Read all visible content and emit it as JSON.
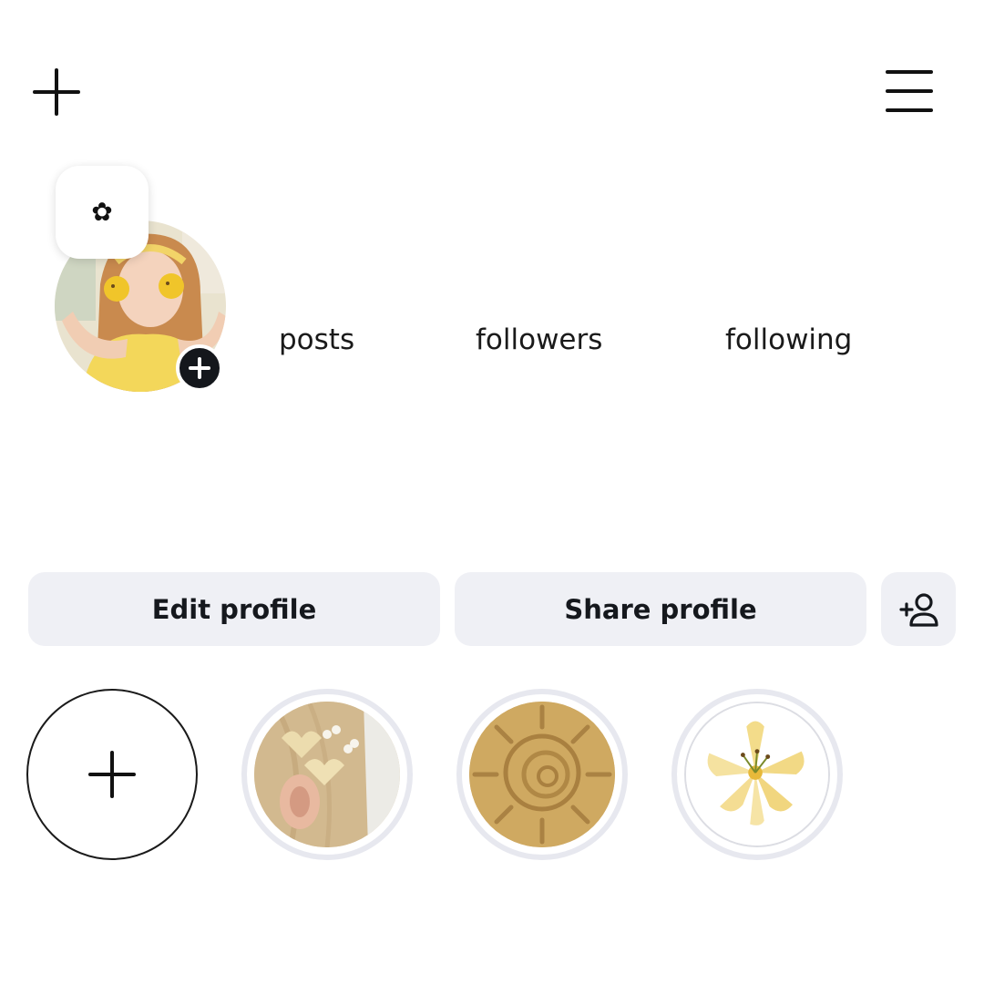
{
  "header": {
    "new_post_icon": "plus-icon",
    "menu_icon": "hamburger-menu-icon"
  },
  "profile": {
    "note": "✿",
    "avatar_icon": "avatar-photo",
    "add_story_icon": "plus-icon"
  },
  "stats": {
    "posts_label": "posts",
    "followers_label": "followers",
    "following_label": "following"
  },
  "actions": {
    "edit_label": "Edit profile",
    "share_label": "Share profile",
    "discover_icon": "add-person-icon"
  },
  "highlights": {
    "new_icon": "plus-icon",
    "items": [
      {
        "icon": "hair-clip-photo"
      },
      {
        "icon": "sun-sand-photo"
      },
      {
        "icon": "lily-flower-photo"
      }
    ]
  },
  "colors": {
    "button_bg": "#eff0f5",
    "highlight_ring": "#e7e8ef",
    "text": "#111111",
    "accent_dark": "#14171c"
  }
}
